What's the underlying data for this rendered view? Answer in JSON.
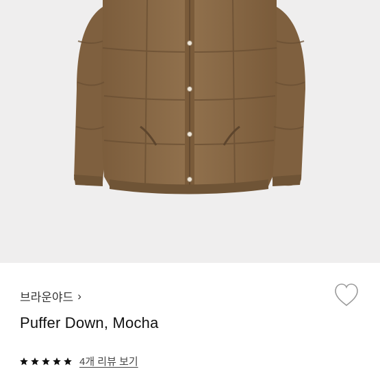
{
  "product": {
    "brand": "브라운야드",
    "name": "Puffer Down, Mocha",
    "rating_stars": 5,
    "reviews_link": "4개 리뷰 보기"
  },
  "icons": {
    "brand_chevron": "chevron-right-icon",
    "wishlist": "heart-outline-icon",
    "star": "star-icon"
  },
  "colors": {
    "hero_background": "#efeeee",
    "jacket": "#8a6a46",
    "star": "#111111"
  }
}
